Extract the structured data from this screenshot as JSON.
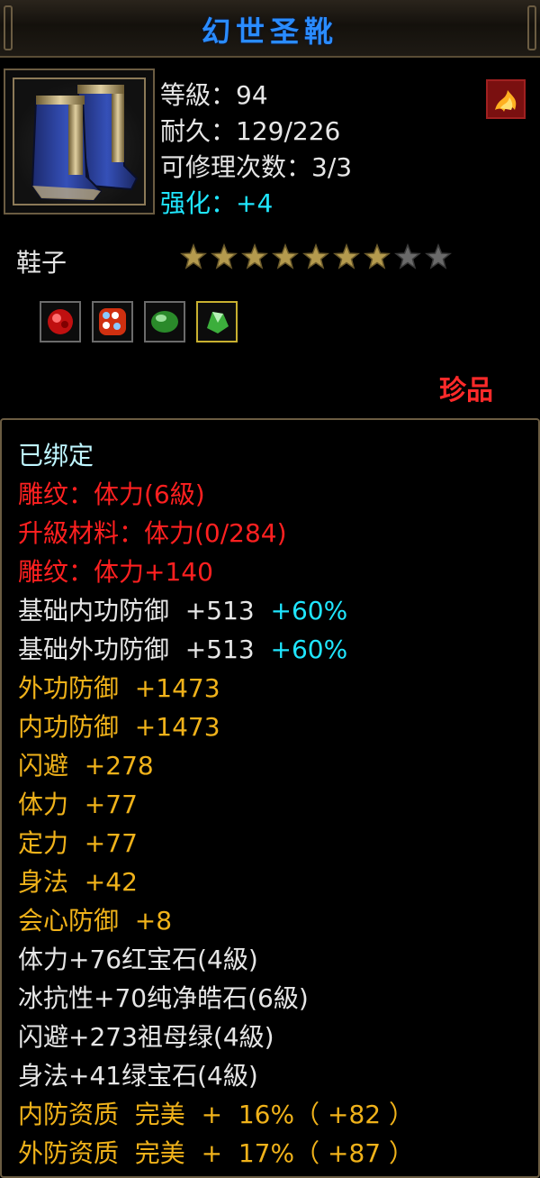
{
  "title": "幻世圣靴",
  "icon": "blue-boots-icon",
  "stats": {
    "level": "等級：94",
    "durability": "耐久：129/226",
    "repair": "可修理次数：3/3",
    "enhance": "强化：+4"
  },
  "type": "鞋子",
  "stars": {
    "filled": 7,
    "total": 9
  },
  "gems": [
    "red-gem-icon",
    "spotted-gem-icon",
    "green-gem-icon",
    "green-crystal-icon"
  ],
  "rarity": "珍品",
  "lines": {
    "bound": "已绑定",
    "engrave1": "雕纹：体力(6級)",
    "upgrade": "升級材料：体力(0/284)",
    "engrave2": "雕纹：体力+140",
    "basic_inner": "基础内功防御  +513",
    "basic_inner_pct": "+60%",
    "basic_outer": "基础外功防御  +513",
    "basic_outer_pct": "+60%",
    "outer_def": "外功防御  +1473",
    "inner_def": "内功防御  +1473",
    "dodge": "闪避  +278",
    "stamina": "体力  +77",
    "focus": "定力  +77",
    "agility": "身法  +42",
    "crit_def": "会心防御  +8",
    "gem1": "体力+76红宝石(4級)",
    "gem2": "冰抗性+70纯净皓石(6級)",
    "gem3": "闪避+273祖母绿(4級)",
    "gem4": "身法+41绿宝石(4級)",
    "inner_quality": "内防资质  完美  +  16%（ +82 ）",
    "outer_quality": "外防资质  完美  +  17%（ +87 ）"
  },
  "colors": {
    "title": "#2a8cff",
    "cyan": "#1fe6ff",
    "red": "#ff2020",
    "yellow": "#f0b21a",
    "white": "#e6e6e6"
  }
}
